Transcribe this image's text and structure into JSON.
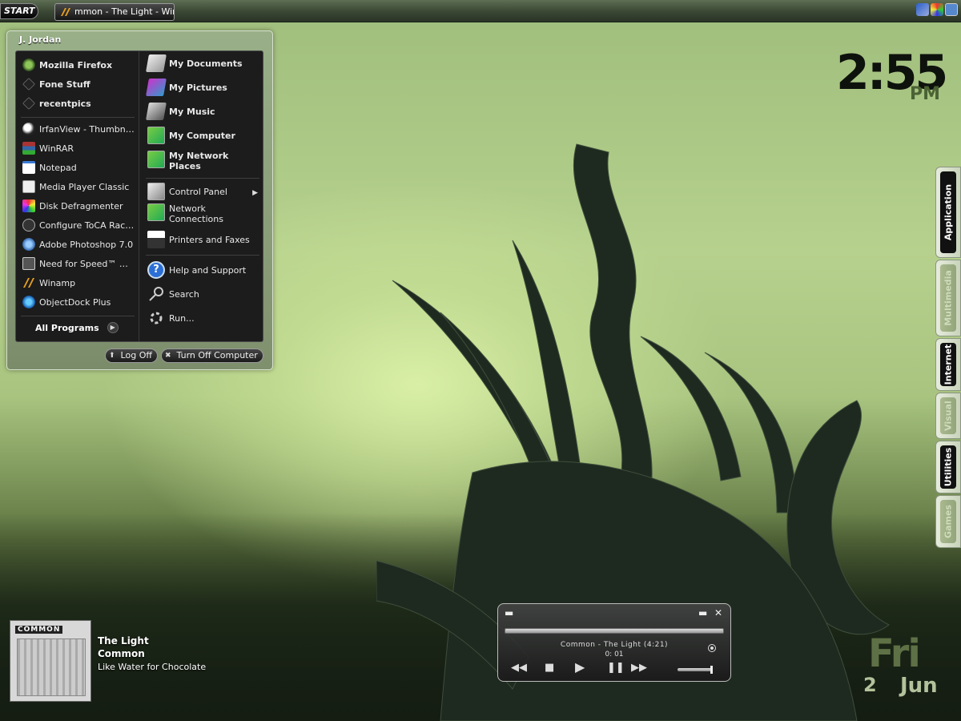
{
  "taskbar": {
    "start_label": "START",
    "task_title": "mmon - The Light - Win..."
  },
  "startmenu": {
    "user": "J. Jordan",
    "pinned": [
      {
        "label": "Mozilla Firefox",
        "icon": "firefox-icon"
      },
      {
        "label": "Fone Stuff",
        "icon": "folder-icon"
      },
      {
        "label": "recentpics",
        "icon": "folder-icon"
      }
    ],
    "recent": [
      {
        "label": "IrfanView - Thumbnails",
        "icon": "irfanview-icon"
      },
      {
        "label": "WinRAR",
        "icon": "winrar-icon"
      },
      {
        "label": "Notepad",
        "icon": "notepad-icon"
      },
      {
        "label": "Media Player Classic",
        "icon": "media-player-icon"
      },
      {
        "label": "Disk Defragmenter",
        "icon": "defrag-icon"
      },
      {
        "label": "Configure ToCA Race ...",
        "icon": "toca-icon"
      },
      {
        "label": "Adobe Photoshop 7.0",
        "icon": "photoshop-icon"
      },
      {
        "label": "Need for Speed™ Mos...",
        "icon": "nfs-icon"
      },
      {
        "label": "Winamp",
        "icon": "winamp-icon"
      },
      {
        "label": "ObjectDock Plus",
        "icon": "objectdock-icon"
      }
    ],
    "all_programs": "All Programs",
    "places": [
      {
        "label": "My Documents",
        "icon": "documents-icon"
      },
      {
        "label": "My Pictures",
        "icon": "pictures-icon"
      },
      {
        "label": "My Music",
        "icon": "music-icon"
      },
      {
        "label": "My Computer",
        "icon": "computer-icon"
      },
      {
        "label": "My Network Places",
        "icon": "network-icon"
      }
    ],
    "system": [
      {
        "label": "Control Panel",
        "icon": "control-panel-icon"
      },
      {
        "label": "Network Connections",
        "icon": "network-connections-icon"
      },
      {
        "label": "Printers and Faxes",
        "icon": "printer-icon"
      }
    ],
    "help": [
      {
        "label": "Help and Support",
        "icon": "help-icon"
      },
      {
        "label": "Search",
        "icon": "search-icon"
      },
      {
        "label": "Run...",
        "icon": "run-icon"
      }
    ],
    "logoff": "Log Off",
    "turnoff": "Turn Off Computer"
  },
  "clock": {
    "time": "2:55",
    "ampm": "PM"
  },
  "sidetabs": [
    "Application",
    "Multimedia",
    "Internet",
    "Visual",
    "Utilities",
    "Games"
  ],
  "nowplaying": {
    "cover_text": "COMMON",
    "title": "The Light",
    "artist": "Common",
    "album": "Like Water for Chocolate"
  },
  "player": {
    "track": "Common - The Light (4:21)",
    "time": "0: 01"
  },
  "date": {
    "day": "Fri",
    "num": "2",
    "month": "Jun"
  },
  "colors": {
    "accent": "#b4c29c",
    "menu_bg": "#1c1c1c"
  }
}
